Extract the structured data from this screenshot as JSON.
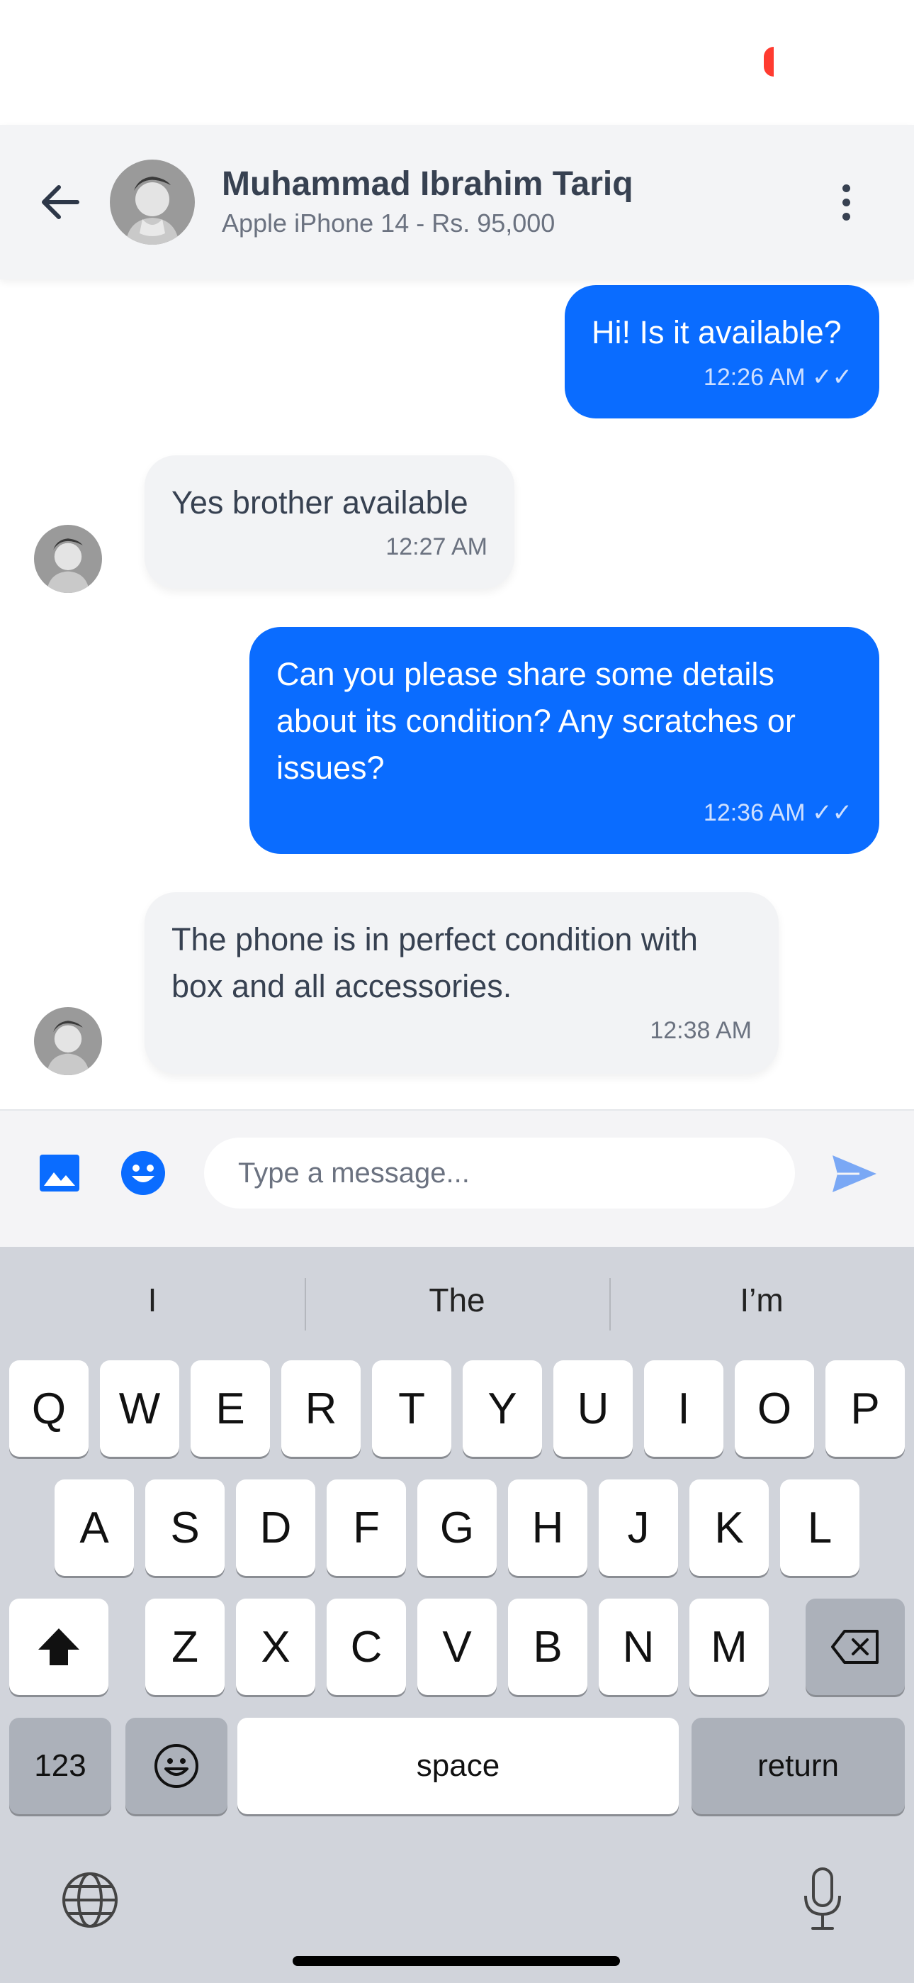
{
  "colors": {
    "accent": "#0a6cff",
    "received_bubble": "#f2f3f5",
    "header_bg": "#f3f4f6",
    "keyboard_bg": "#d1d4db",
    "status_indicator": "#ff3b30"
  },
  "header": {
    "contact_name": "Muhammad Ibrahim Tariq",
    "listing": "Apple iPhone 14 - Rs. 95,000",
    "icons": {
      "back": "arrow-left-icon",
      "more": "more-vertical-icon",
      "avatar": "user-avatar"
    }
  },
  "messages": [
    {
      "direction": "sent",
      "text": "Hi! Is it available?",
      "time": "12:26 AM",
      "status": "✓✓"
    },
    {
      "direction": "received",
      "text": "Yes brother available",
      "time": "12:27 AM"
    },
    {
      "direction": "sent",
      "text": "Can you please share some details about its condition? Any scratches or issues?",
      "time": "12:36 AM",
      "status": "✓✓"
    },
    {
      "direction": "received",
      "text": "The phone is in perfect condition with box and all accessories.",
      "time": "12:38 AM"
    }
  ],
  "composer": {
    "placeholder": "Type a message...",
    "value": "",
    "icons": {
      "image": "image-icon",
      "emoji": "emoji-icon",
      "send": "send-icon"
    }
  },
  "keyboard": {
    "suggestions": [
      "I",
      "The",
      "I’m"
    ],
    "row1": [
      "Q",
      "W",
      "E",
      "R",
      "T",
      "Y",
      "U",
      "I",
      "O",
      "P"
    ],
    "row2": [
      "A",
      "S",
      "D",
      "F",
      "G",
      "H",
      "J",
      "K",
      "L"
    ],
    "row3": [
      "Z",
      "X",
      "C",
      "V",
      "B",
      "N",
      "M"
    ],
    "numbers_label": "123",
    "space_label": "space",
    "return_label": "return",
    "icons": {
      "shift": "shift-icon",
      "delete": "backspace-icon",
      "emoji": "emoji-icon",
      "globe": "globe-icon",
      "mic": "microphone-icon"
    }
  }
}
